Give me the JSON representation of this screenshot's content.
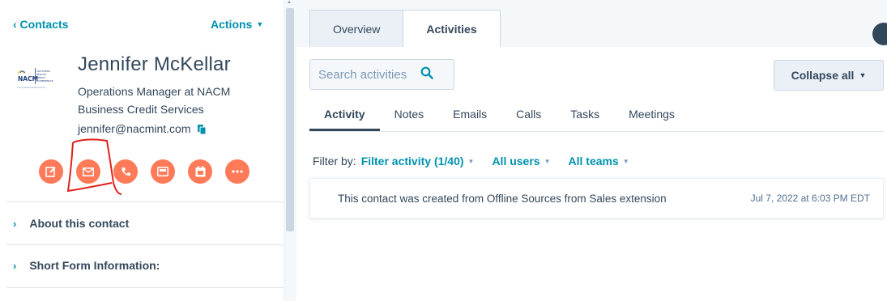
{
  "sidebar": {
    "back_label": "‹ Contacts",
    "actions_label": "Actions",
    "contact": {
      "name": "Jennifer McKellar",
      "title": "Operations Manager at NACM Business Credit Services",
      "email": "jennifer@nacmint.com"
    },
    "logo_text": {
      "brand": "NACM",
      "region": "SOUTHERN REGION CREDIT CONFERENCE",
      "tagline": "Unsurpassed Relationships"
    },
    "action_buttons": [
      "note-icon",
      "email-icon",
      "phone-icon",
      "message-icon",
      "calendar-icon",
      "more-icon"
    ],
    "sections": [
      {
        "label": "About this contact"
      },
      {
        "label": "Short Form Information:"
      }
    ]
  },
  "main": {
    "tabs": [
      {
        "label": "Overview"
      },
      {
        "label": "Activities"
      }
    ],
    "search": {
      "placeholder": "Search activities"
    },
    "collapse_label": "Collapse all",
    "subtabs": [
      {
        "label": "Activity"
      },
      {
        "label": "Notes"
      },
      {
        "label": "Emails"
      },
      {
        "label": "Calls"
      },
      {
        "label": "Tasks"
      },
      {
        "label": "Meetings"
      }
    ],
    "filter": {
      "label": "Filter by:",
      "activity": "Filter activity (1/40)",
      "users": "All users",
      "teams": "All teams"
    },
    "activity_item": {
      "text": "This contact was created from Offline Sources from Sales extension",
      "timestamp": "Jul 7, 2022 at 6:03 PM EDT"
    }
  },
  "colors": {
    "accent": "#0091ae",
    "action_orange": "#ff7a59",
    "text": "#33475b",
    "annotation_red": "#e0201b"
  }
}
